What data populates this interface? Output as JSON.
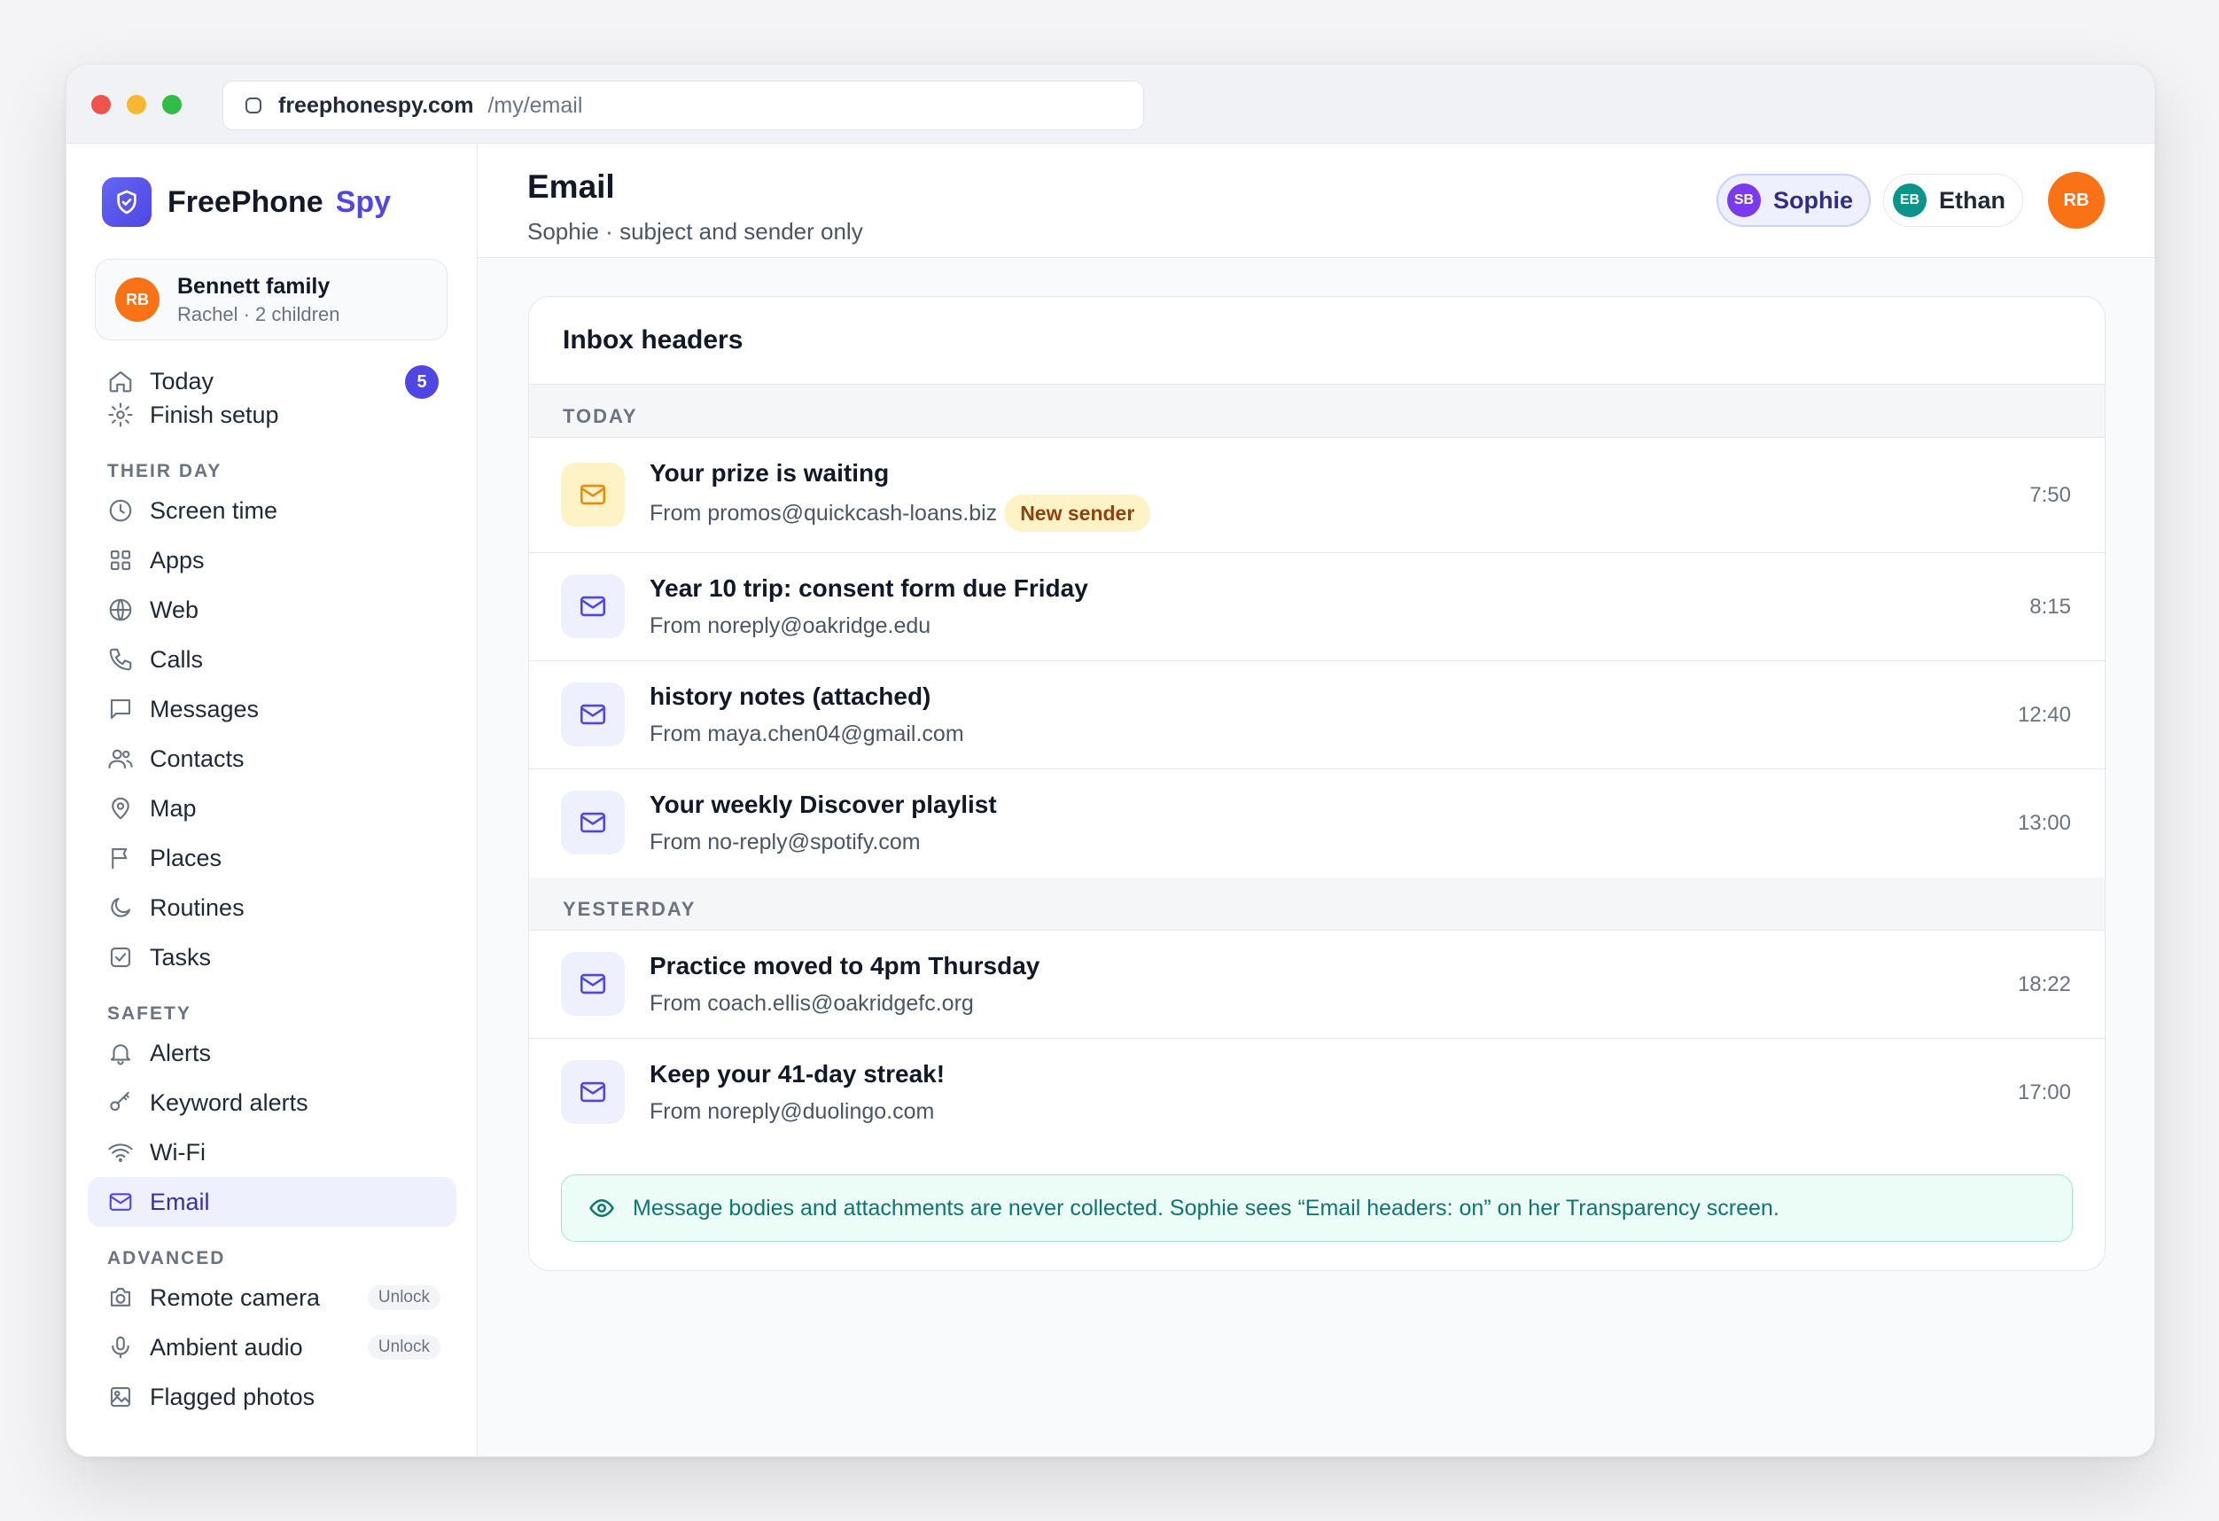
{
  "browser": {
    "domain": "freephonespy.com",
    "path": "/my/email"
  },
  "brand": {
    "name": "FreePhone",
    "accent": "Spy",
    "color": "#4f46e5"
  },
  "family": {
    "initials": "RB",
    "name": "Bennett family",
    "sub": "Rachel · 2 children"
  },
  "nav": {
    "top": [
      {
        "label": "Today",
        "icon": "home-icon",
        "badge": "5"
      },
      {
        "label": "Finish setup",
        "icon": "gear-icon"
      }
    ],
    "their_day_label": "THEIR DAY",
    "their_day": [
      {
        "label": "Screen time",
        "icon": "clock-icon"
      },
      {
        "label": "Apps",
        "icon": "grid-icon"
      },
      {
        "label": "Web",
        "icon": "globe-icon"
      },
      {
        "label": "Calls",
        "icon": "phone-icon"
      },
      {
        "label": "Messages",
        "icon": "chat-icon"
      },
      {
        "label": "Contacts",
        "icon": "users-icon"
      },
      {
        "label": "Map",
        "icon": "pin-icon"
      },
      {
        "label": "Places",
        "icon": "flag-icon"
      },
      {
        "label": "Routines",
        "icon": "moon-icon"
      },
      {
        "label": "Tasks",
        "icon": "checkbox-icon"
      }
    ],
    "safety_label": "SAFETY",
    "safety": [
      {
        "label": "Alerts",
        "icon": "bell-icon"
      },
      {
        "label": "Keyword alerts",
        "icon": "key-icon"
      },
      {
        "label": "Wi-Fi",
        "icon": "wifi-icon"
      },
      {
        "label": "Email",
        "icon": "mail-icon",
        "active": true
      }
    ],
    "advanced_label": "ADVANCED",
    "advanced": [
      {
        "label": "Remote camera",
        "icon": "camera-icon",
        "pill": "Unlock"
      },
      {
        "label": "Ambient audio",
        "icon": "mic-icon",
        "pill": "Unlock"
      },
      {
        "label": "Flagged photos",
        "icon": "image-icon"
      }
    ]
  },
  "header": {
    "title": "Email",
    "subtitle": "Sophie · subject and sender only",
    "children": [
      {
        "initials": "SB",
        "name": "Sophie",
        "color": "#7c3aed",
        "selected": true
      },
      {
        "initials": "EB",
        "name": "Ethan",
        "color": "#0d9488",
        "selected": false
      }
    ],
    "user_initials": "RB"
  },
  "inbox": {
    "title": "Inbox headers",
    "groups": [
      {
        "label": "TODAY",
        "rows": [
          {
            "subject": "Your prize is waiting",
            "from": "From promos@quickcash-loans.biz",
            "tag": "New sender",
            "time": "7:50",
            "warn": true
          },
          {
            "subject": "Year 10 trip: consent form due Friday",
            "from": "From noreply@oakridge.edu",
            "time": "8:15"
          },
          {
            "subject": "history notes (attached)",
            "from": "From maya.chen04@gmail.com",
            "time": "12:40"
          },
          {
            "subject": "Your weekly Discover playlist",
            "from": "From no-reply@spotify.com",
            "time": "13:00"
          }
        ]
      },
      {
        "label": "YESTERDAY",
        "rows": [
          {
            "subject": "Practice moved to 4pm Thursday",
            "from": "From coach.ellis@oakridgefc.org",
            "time": "18:22"
          },
          {
            "subject": "Keep your 41-day streak!",
            "from": "From noreply@duolingo.com",
            "time": "17:00"
          }
        ]
      }
    ],
    "notice": "Message bodies and attachments are never collected. Sophie sees “Email headers: on” on her Transparency screen."
  }
}
